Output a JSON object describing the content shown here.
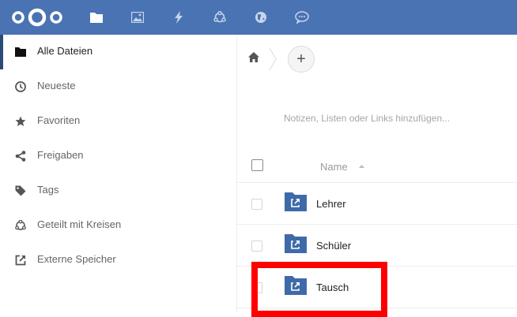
{
  "topbar": {
    "color": "#4a73b3",
    "logo": "nextcloud-logo",
    "apps": [
      {
        "name": "files-icon"
      },
      {
        "name": "photos-icon"
      },
      {
        "name": "activity-icon"
      },
      {
        "name": "circles-icon"
      },
      {
        "name": "globe-icon"
      },
      {
        "name": "talk-icon"
      }
    ]
  },
  "sidebar": {
    "items": [
      {
        "label": "Alle Dateien",
        "icon": "folder-icon",
        "active": true
      },
      {
        "label": "Neueste",
        "icon": "clock-icon"
      },
      {
        "label": "Favoriten",
        "icon": "star-icon"
      },
      {
        "label": "Freigaben",
        "icon": "share-icon"
      },
      {
        "label": "Tags",
        "icon": "tag-icon"
      },
      {
        "label": "Geteilt mit Kreisen",
        "icon": "circles-icon"
      },
      {
        "label": "Externe Speicher",
        "icon": "external-link-icon"
      }
    ]
  },
  "main": {
    "add_button": "+",
    "notes_placeholder": "Notizen, Listen oder Links hinzufügen...",
    "table": {
      "column_name": "Name",
      "rows": [
        {
          "name": "Lehrer"
        },
        {
          "name": "Schüler"
        },
        {
          "name": "Tausch"
        }
      ]
    }
  },
  "highlight_color": "#ff0000"
}
